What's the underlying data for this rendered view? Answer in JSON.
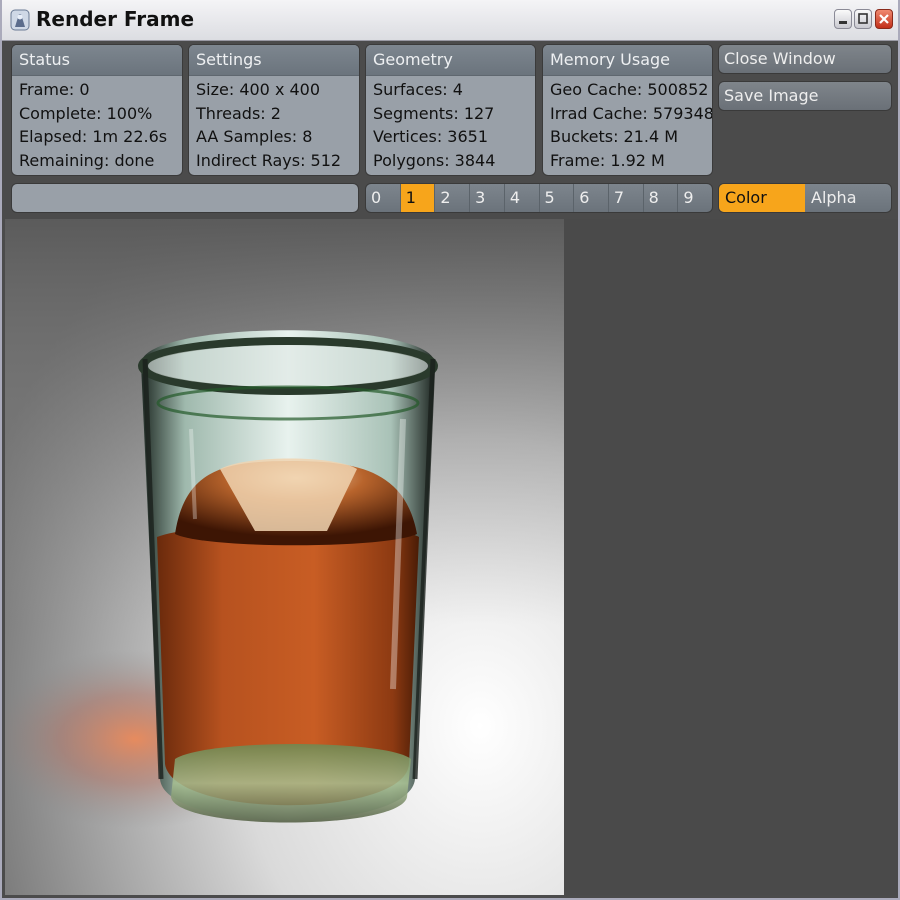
{
  "window": {
    "title": "Render Frame"
  },
  "panels": [
    {
      "title": "Status",
      "rows": [
        "Frame: 0",
        "Complete: 100%",
        "Elapsed: 1m 22.6s",
        "Remaining: done"
      ]
    },
    {
      "title": "Settings",
      "rows": [
        "Size: 400 x 400",
        "Threads: 2",
        "AA Samples: 8",
        "Indirect Rays: 512"
      ]
    },
    {
      "title": "Geometry",
      "rows": [
        "Surfaces: 4",
        "Segments: 127",
        "Vertices: 3651",
        "Polygons: 3844"
      ]
    },
    {
      "title": "Memory Usage",
      "rows": [
        "Geo Cache: 500852",
        "Irrad Cache: 579348",
        "Buckets: 21.4 M",
        "Frame: 1.92 M"
      ]
    }
  ],
  "buttons": {
    "close": "Close Window",
    "save": "Save Image"
  },
  "buffers": [
    "0",
    "1",
    "2",
    "3",
    "4",
    "5",
    "6",
    "7",
    "8",
    "9"
  ],
  "active_buffer": "1",
  "modes": {
    "color": "Color",
    "alpha": "Alpha",
    "active": "Color"
  },
  "colors": {
    "accent": "#f7a51b",
    "panel": "#99a0a8",
    "background": "#4a4a4a"
  },
  "icons": {
    "app": "render-app-icon",
    "minimize": "minimize-icon",
    "maximize": "maximize-icon",
    "close": "close-icon"
  }
}
